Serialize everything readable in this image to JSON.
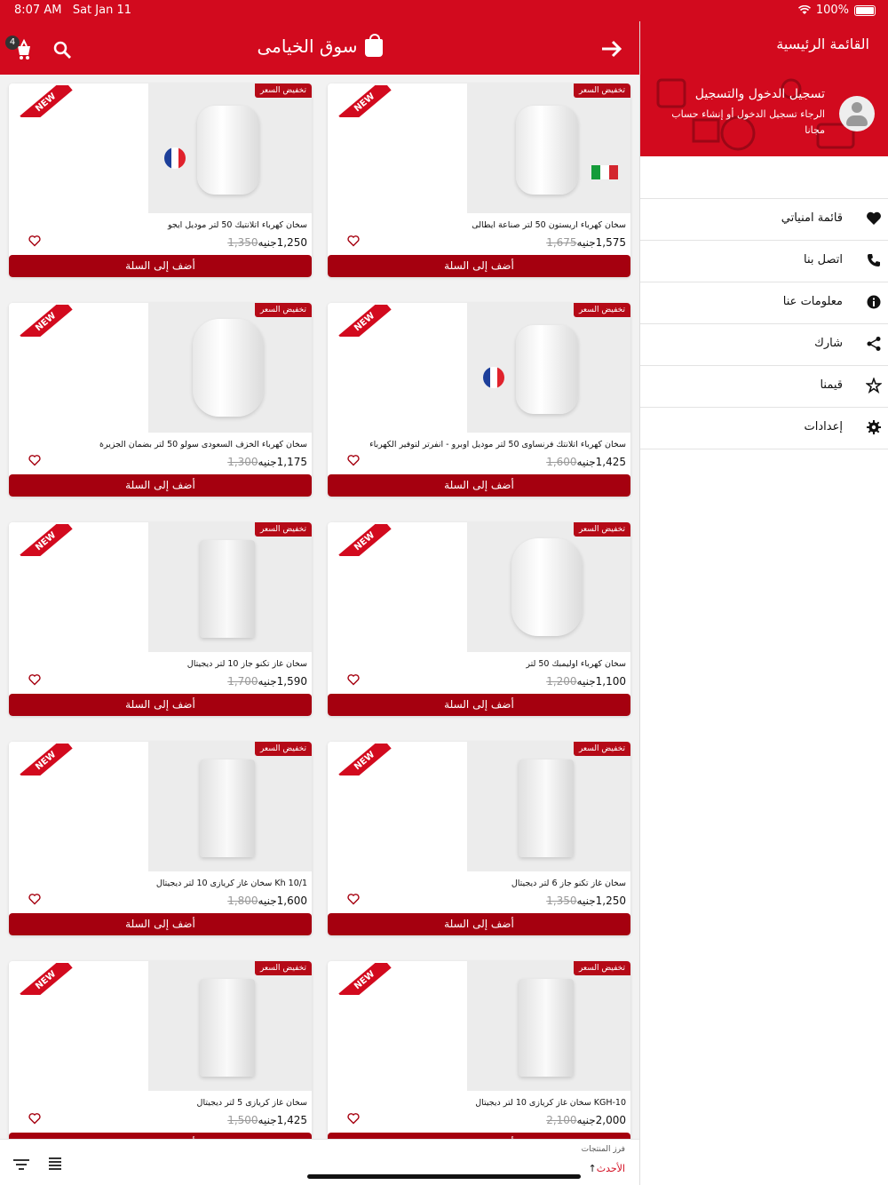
{
  "status": {
    "time": "8:07 AM",
    "date": "Sat Jan 11",
    "battery": "100%"
  },
  "header": {
    "title": "سوق الخيامى",
    "cart_count": "4"
  },
  "labels": {
    "sale": "تخفيض السعر",
    "new": "NEW",
    "add_to_cart": "أضف إلى السلة",
    "currency": "جنيه"
  },
  "products": [
    {
      "name": "سخان كهرباء اريستون 50 لتر صناعة ايطالى",
      "price": "1,575",
      "old_price": "1,675"
    },
    {
      "name": "سخان كهرباء اتلانتيك 50 لتر موديل ايجو",
      "price": "1,250",
      "old_price": "1,350"
    },
    {
      "name": "سخان كهرباء اتلانتك فرنساوى 50 لتر موديل اوبرو - انفرتر لتوفير الكهرباء",
      "price": "1,425",
      "old_price": "1,600"
    },
    {
      "name": "سخان كهرباء الخزف السعودى سولو 50 لتر بضمان الجزيرة",
      "price": "1,175",
      "old_price": "1,300"
    },
    {
      "name": "سخان كهرباء اوليمبك 50 لتر",
      "price": "1,100",
      "old_price": "1,200"
    },
    {
      "name": "سخان غاز تكنو جاز 10 لتر ديجيتال",
      "price": "1,590",
      "old_price": "1,700"
    },
    {
      "name": "سخان غاز تكنو جاز 6 لتر ديجيتال",
      "price": "1,250",
      "old_price": "1,350"
    },
    {
      "name": "سخان غاز كريازى 10 لتر ديجيتال Kh 10/1",
      "price": "1,600",
      "old_price": "1,800"
    },
    {
      "name": "سخان غاز كريازى 10 لتر ديجيتال KGH-10",
      "price": "2,000",
      "old_price": "2,100"
    },
    {
      "name": "سخان غاز كريازى 5 لتر ديجيتال",
      "price": "1,425",
      "old_price": "1,500"
    }
  ],
  "bottom": {
    "sort_label": "فرز المنتجات",
    "sort_value": "الأحدث"
  },
  "drawer": {
    "title": "القائمة الرئيسية",
    "login_title": "تسجيل الدخول والتسجيل",
    "login_sub": "الرجاء تسجيل الدخول أو إنشاء حساب مجانا",
    "items": [
      {
        "label": "قائمة امنياتي",
        "icon": "heart-icon"
      },
      {
        "label": "اتصل بنا",
        "icon": "phone-icon"
      },
      {
        "label": "معلومات عنا",
        "icon": "info-icon"
      },
      {
        "label": "شارك",
        "icon": "share-icon"
      },
      {
        "label": "قيمنا",
        "icon": "star-icon"
      },
      {
        "label": "إعدادات",
        "icon": "settings-icon"
      }
    ]
  }
}
